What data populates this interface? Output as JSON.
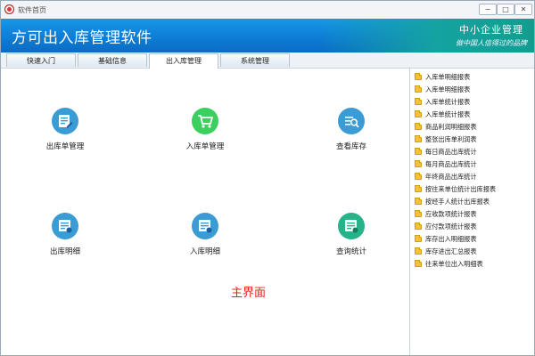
{
  "window": {
    "title": "软件首页",
    "btn_min": "−",
    "btn_max": "□",
    "btn_close": "✕"
  },
  "header": {
    "app_title": "方可出入库管理软件",
    "company": "中小企业管理",
    "slogan": "做中国人信得过的品牌"
  },
  "tabs": [
    "快速入门",
    "基础信息",
    "出入库管理",
    "系统管理"
  ],
  "active_tab": "出入库管理",
  "tiles": [
    {
      "label": "出库单管理",
      "icon": "edit-icon"
    },
    {
      "label": "入库单管理",
      "icon": "cart-icon"
    },
    {
      "label": "查看库存",
      "icon": "search-doc-icon"
    },
    {
      "label": "出库明细",
      "icon": "list-icon"
    },
    {
      "label": "入库明细",
      "icon": "list-icon"
    },
    {
      "label": "查询统计",
      "icon": "stats-icon"
    }
  ],
  "main_label": "主界面",
  "reports": [
    "入库单明细报表",
    "入库单明细报表",
    "入库单统计报表",
    "入库单统计报表",
    "商品利润明细报表",
    "整张出库单利润表",
    "每日商品出库统计",
    "每月商品出库统计",
    "年终商品出库统计",
    "按往来单位统计出库报表",
    "按经手人统计出库报表",
    "应收款项统计报表",
    "应付款项统计报表",
    "库存出入明细报表",
    "库存进出汇总报表",
    "往来单位出入明细表"
  ],
  "colors": {
    "header_blue": "#0f7dd6",
    "header_teal": "#119d8f",
    "main_label": "#e8231d",
    "folder": "#f3c23a"
  }
}
